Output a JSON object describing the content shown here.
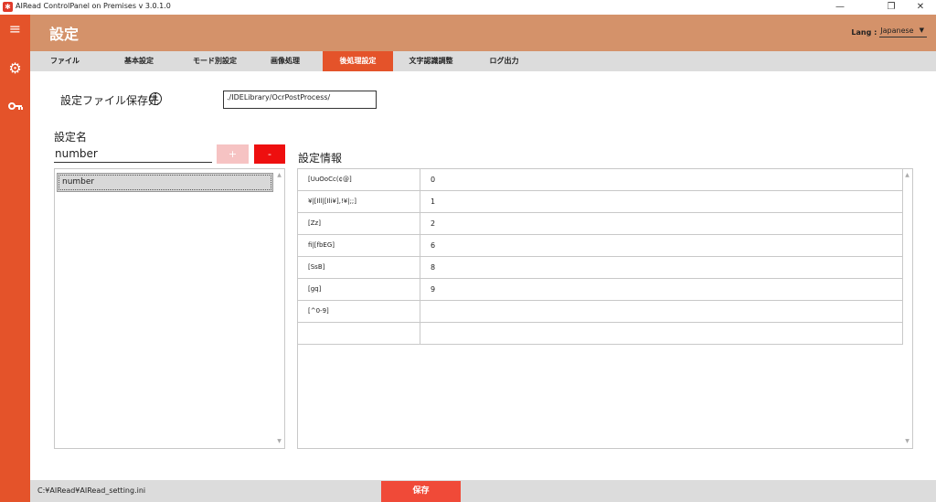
{
  "window": {
    "title": "AIRead ControlPanel on Premises v 3.0.1.0",
    "minimize": "—",
    "maximize": "❐",
    "close": "✕"
  },
  "sidebar": {
    "items": [
      {
        "icon": "menu-icon",
        "glyph": "≡"
      },
      {
        "icon": "gear-icon",
        "glyph": "⚙"
      },
      {
        "icon": "key-icon",
        "glyph": "⚷"
      }
    ]
  },
  "header": {
    "title": "設定",
    "lang_label": "Lang :",
    "lang_value": "Japanese",
    "lang_caret": "▼"
  },
  "tabs": [
    {
      "label": "ファイル"
    },
    {
      "label": "基本設定"
    },
    {
      "label": "モード別設定"
    },
    {
      "label": "画像処理"
    },
    {
      "label": "後処理設定",
      "active": true
    },
    {
      "label": "文字認識調整"
    },
    {
      "label": "ログ出力"
    }
  ],
  "settings": {
    "save_location_label": "設定ファイル保存先",
    "info_glyph": "i",
    "save_location_value": "./IDELibrary/OcrPostProcess/",
    "name_label": "設定名",
    "name_value": "number",
    "add_label": "+",
    "delete_label": "-",
    "list_items": [
      "number"
    ],
    "scroll_up": "▲",
    "scroll_down": "▼",
    "info_label": "設定情報",
    "rows": [
      {
        "key": "[UuOoCc(¢@]",
        "value": "0"
      },
      {
        "key": "¥|[Ill|[Ili¥],!¥|;;]",
        "value": "1"
      },
      {
        "key": "[Zz]",
        "value": "2"
      },
      {
        "key": "fi|[fbEG]",
        "value": "6"
      },
      {
        "key": "[SsB]",
        "value": "8"
      },
      {
        "key": "[gq]",
        "value": "9"
      },
      {
        "key": "[^0-9]",
        "value": ""
      },
      {
        "key": "",
        "value": ""
      }
    ]
  },
  "footer": {
    "path": "C:¥AIRead¥AIRead_setting.ini",
    "save_label": "保存"
  },
  "colors": {
    "sidebar": "#e4532a",
    "header": "#d4926a",
    "active_tab": "#e4532a",
    "save_button": "#f04a38",
    "delete_button": "#ee0f0f",
    "add_button": "#f6c3c3"
  }
}
